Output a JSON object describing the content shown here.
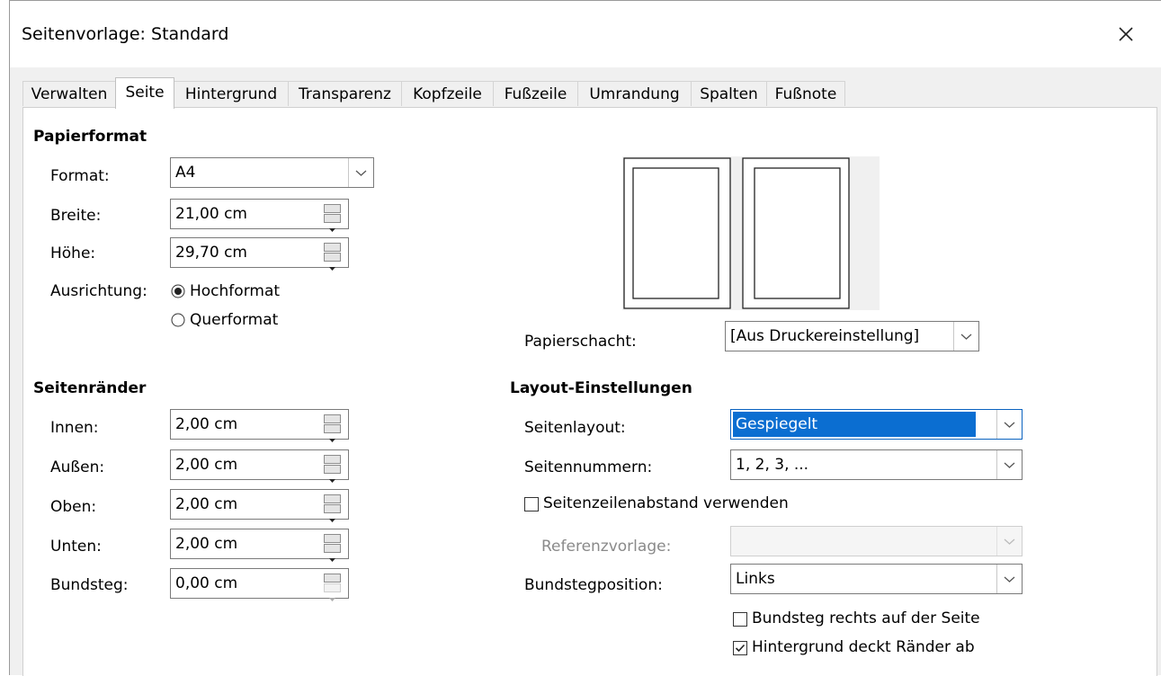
{
  "window": {
    "title": "Seitenvorlage: Standard",
    "close_icon": "close-icon"
  },
  "tabs": [
    "Verwalten",
    "Seite",
    "Hintergrund",
    "Transparenz",
    "Kopfzeile",
    "Fußzeile",
    "Umrandung",
    "Spalten",
    "Fußnote"
  ],
  "active_tab": "Seite",
  "papierformat": {
    "heading": "Papierformat",
    "format_label": "Format:",
    "format_value": "A4",
    "breite_label": "Breite:",
    "breite_value": "21,00 cm",
    "hoehe_label": "Höhe:",
    "hoehe_value": "29,70 cm",
    "ausrichtung_label": "Ausrichtung:",
    "hochformat_label": "Hochformat",
    "querformat_label": "Querformat",
    "orientation_selected": "Hochformat"
  },
  "papierschacht": {
    "label": "Papierschacht:",
    "value": "[Aus Druckereinstellung]"
  },
  "seitenraender": {
    "heading": "Seitenränder",
    "innen_label": "Innen:",
    "innen_value": "2,00 cm",
    "aussen_label": "Außen:",
    "aussen_value": "2,00 cm",
    "oben_label": "Oben:",
    "oben_value": "2,00 cm",
    "unten_label": "Unten:",
    "unten_value": "2,00 cm",
    "bundsteg_label": "Bundsteg:",
    "bundsteg_value": "0,00 cm"
  },
  "layout": {
    "heading": "Layout-Einstellungen",
    "seitenlayout_label": "Seitenlayout:",
    "seitenlayout_value": "Gespiegelt",
    "seitennummern_label": "Seitennummern:",
    "seitennummern_value": "1, 2, 3, ...",
    "register_label": "Seitenzeilenabstand verwenden",
    "register_checked": false,
    "referenz_label": "Referenzvorlage:",
    "referenz_value": "",
    "bundstegposition_label": "Bundstegposition:",
    "bundstegposition_value": "Links",
    "bundsteg_rechts_label": "Bundsteg rechts auf der Seite",
    "bundsteg_rechts_checked": false,
    "hintergrund_label": "Hintergrund deckt Ränder ab",
    "hintergrund_checked": true
  },
  "colors": {
    "accent": "#0b6ed1",
    "dialog_bg": "#f0f0f0",
    "panel_bg": "#ffffff"
  }
}
